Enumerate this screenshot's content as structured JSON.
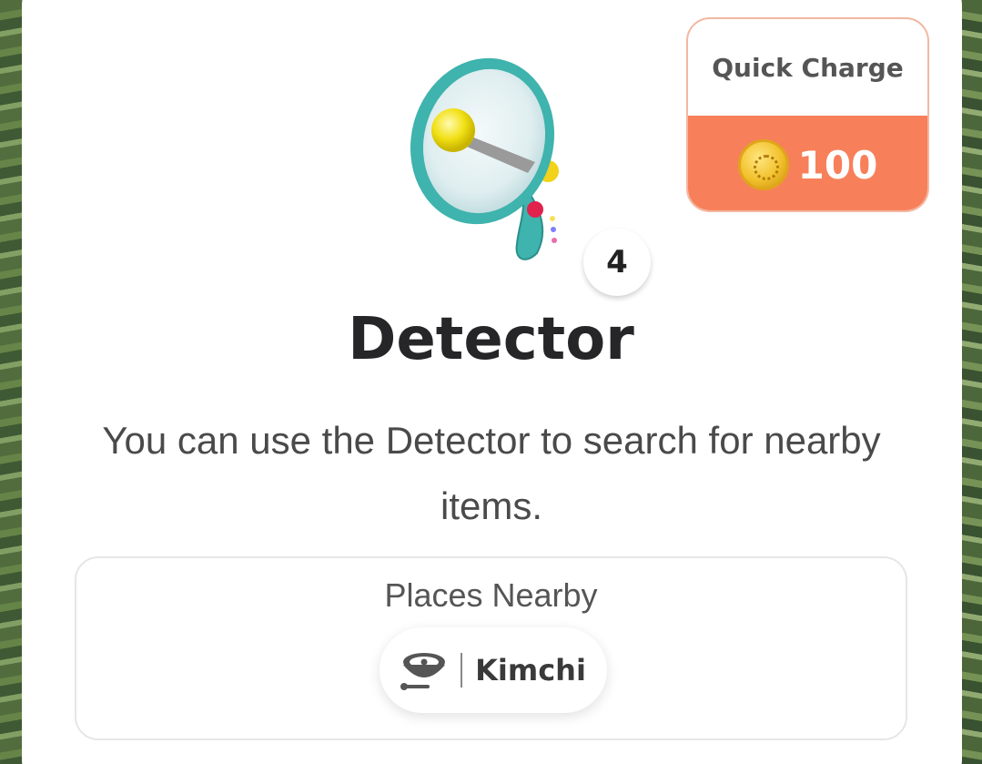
{
  "quick_charge": {
    "label": "Quick Charge",
    "cost": "100",
    "accent_color": "#f7805a"
  },
  "item": {
    "name": "Detector",
    "count": "4",
    "icon": "detector-megaphone-icon",
    "description": "You can use the Detector to search for nearby items."
  },
  "places": {
    "title": "Places Nearby",
    "items": [
      {
        "icon": "bowl-icon",
        "label": "Kimchi"
      }
    ]
  }
}
